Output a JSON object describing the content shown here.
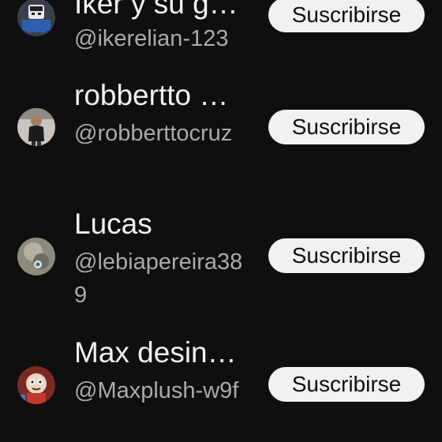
{
  "channels": [
    {
      "name": "Iker y su g…",
      "handle": "@ikerelian-123",
      "subscribe_label": "Suscribirse",
      "avatar_icon": "roblox-character-avatar"
    },
    {
      "name": "robbertto …",
      "handle": "@robberttocruz",
      "subscribe_label": "Suscribirse",
      "avatar_icon": "person-photo-avatar"
    },
    {
      "name": "Lucas",
      "handle": "@lebiapereira389",
      "subscribe_label": "Suscribirse",
      "avatar_icon": "blurred-photo-avatar"
    },
    {
      "name": "Max desin…",
      "handle": "@Maxplush-w9f",
      "subscribe_label": "Suscribirse",
      "avatar_icon": "plush-toy-avatar"
    }
  ],
  "colors": {
    "background": "#0f0f0f",
    "primary_text": "#f1f1f1",
    "secondary_text": "#aaaaaa",
    "button_bg": "#f1f1f1",
    "button_text": "#0f0f0f"
  }
}
